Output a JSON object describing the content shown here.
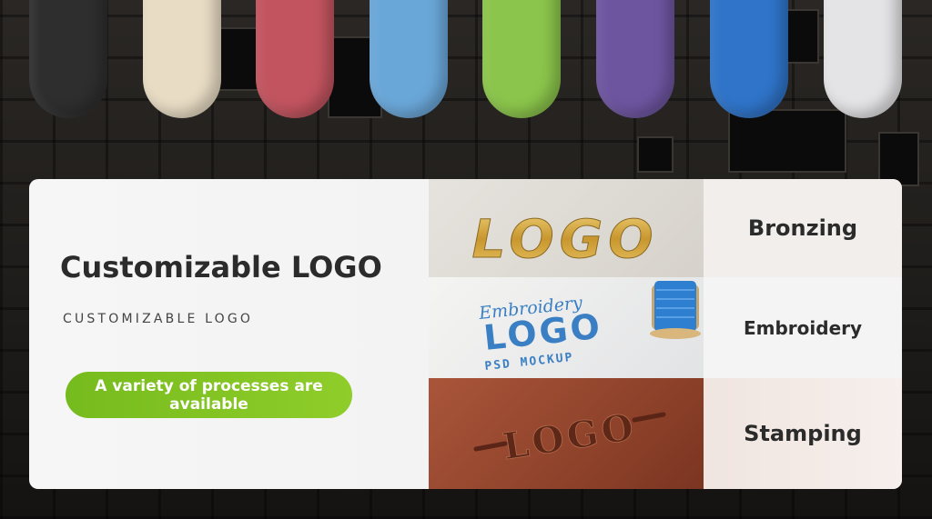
{
  "swatches": [
    {
      "name": "black",
      "color": "#2e2e2e"
    },
    {
      "name": "cream",
      "color": "#e8dcc4"
    },
    {
      "name": "red",
      "color": "#c2545f"
    },
    {
      "name": "light-blue",
      "color": "#6aa7d9"
    },
    {
      "name": "green",
      "color": "#8bc54b"
    },
    {
      "name": "purple",
      "color": "#6e55a0"
    },
    {
      "name": "blue",
      "color": "#2f74c9"
    },
    {
      "name": "white",
      "color": "#e4e4e6"
    }
  ],
  "card": {
    "title": "Customizable LOGO",
    "subtitle": "CUSTOMIZABLE LOGO",
    "cta": "A variety of processes are available"
  },
  "processes": [
    {
      "label": "Bronzing",
      "sample_text": "LOGO"
    },
    {
      "label": "Embroidery",
      "sample_script": "Embroidery",
      "sample_text": "LOGO",
      "sample_caption": "PSD MOCKUP"
    },
    {
      "label": "Stamping",
      "sample_text": "LOGO"
    }
  ],
  "colors": {
    "accent_green": "#7fc223",
    "gold": "#d4a645",
    "thread_blue": "#3a7fc4"
  }
}
